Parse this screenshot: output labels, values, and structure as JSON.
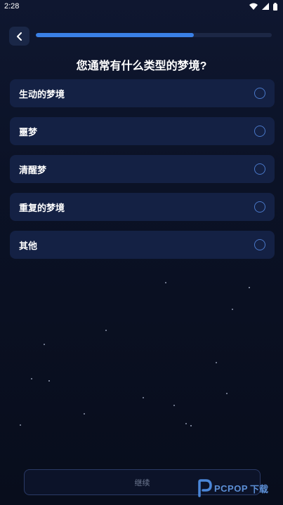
{
  "status_bar": {
    "time": "2:28"
  },
  "progress": {
    "fraction": 0.67
  },
  "question": "您通常有什么类型的梦境?",
  "options": [
    {
      "label": "生动的梦境"
    },
    {
      "label": "噩梦"
    },
    {
      "label": "清醒梦"
    },
    {
      "label": "重复的梦境"
    },
    {
      "label": "其他"
    }
  ],
  "continue_label": "继续",
  "watermark": {
    "brand": "PCPOP",
    "suffix": "下载"
  },
  "colors": {
    "accent": "#3a80e6",
    "option_bg": "#142144",
    "radio": "#4a78c8"
  }
}
